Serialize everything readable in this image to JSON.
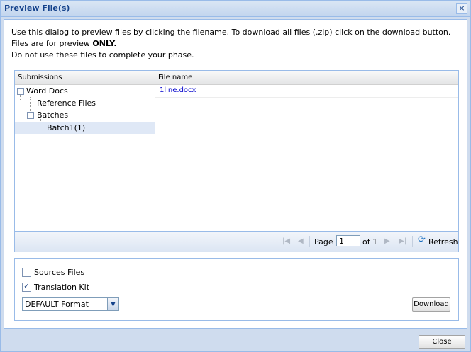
{
  "dialog": {
    "title": "Preview File(s)",
    "close_glyph": "×"
  },
  "info": {
    "line1": "Use this dialog to preview files by clicking the filename. To download all files (.zip) click on the download button.",
    "line2_prefix": "Files are for preview ",
    "line2_bold": "ONLY.",
    "line3": "Do not use these files to complete your phase."
  },
  "grid": {
    "left_header": "Submissions",
    "right_header": "File name",
    "tree": [
      {
        "label": "Word Docs",
        "toggle": "−"
      },
      {
        "label": "Reference Files"
      },
      {
        "label": "Batches",
        "toggle": "−"
      },
      {
        "label": "Batch1(1)"
      }
    ],
    "files": [
      {
        "name": "1line.docx"
      }
    ]
  },
  "pager": {
    "page_label": "Page",
    "page_value": "1",
    "of_label": "of 1",
    "refresh_label": "Refresh"
  },
  "options": {
    "sources_label": "Sources Files",
    "sources_checked": false,
    "translation_label": "Translation Kit",
    "translation_checked": true,
    "format_value": "DEFAULT Format",
    "download_label": "Download"
  },
  "footer": {
    "close_label": "Close"
  }
}
